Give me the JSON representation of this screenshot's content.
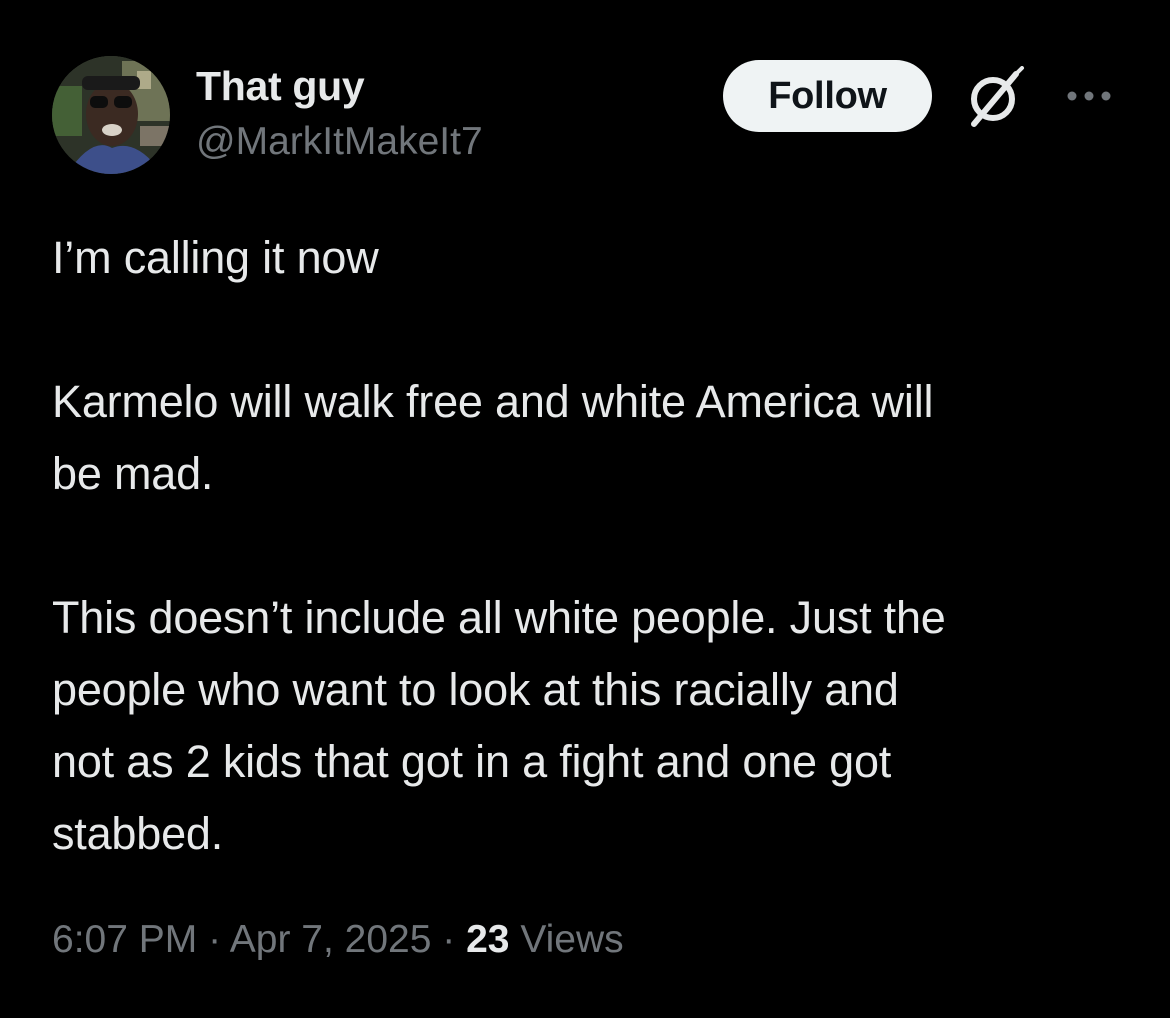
{
  "author": {
    "display_name": "That guy",
    "handle": "@MarkItMakeIt7"
  },
  "actions": {
    "follow_label": "Follow",
    "grok_icon": "grok-icon",
    "more_icon": "more-options-icon"
  },
  "tweet": {
    "paragraphs": [
      "I’m calling it now",
      "Karmelo will walk free and white America will\nbe mad.",
      "This doesn’t include all white people. Just the\npeople who want to look at this racially and\nnot as 2 kids that got in a fight and one got\nstabbed."
    ]
  },
  "meta": {
    "time": "6:07 PM",
    "separator1": " · ",
    "date": "Apr 7, 2025",
    "separator2": " · ",
    "views_count": "23",
    "views_label": " Views"
  },
  "colors": {
    "background": "#000000",
    "primary_text": "#e7e9ea",
    "secondary_text": "#71767b",
    "follow_bg": "#eff3f4",
    "follow_text": "#0f1419"
  }
}
